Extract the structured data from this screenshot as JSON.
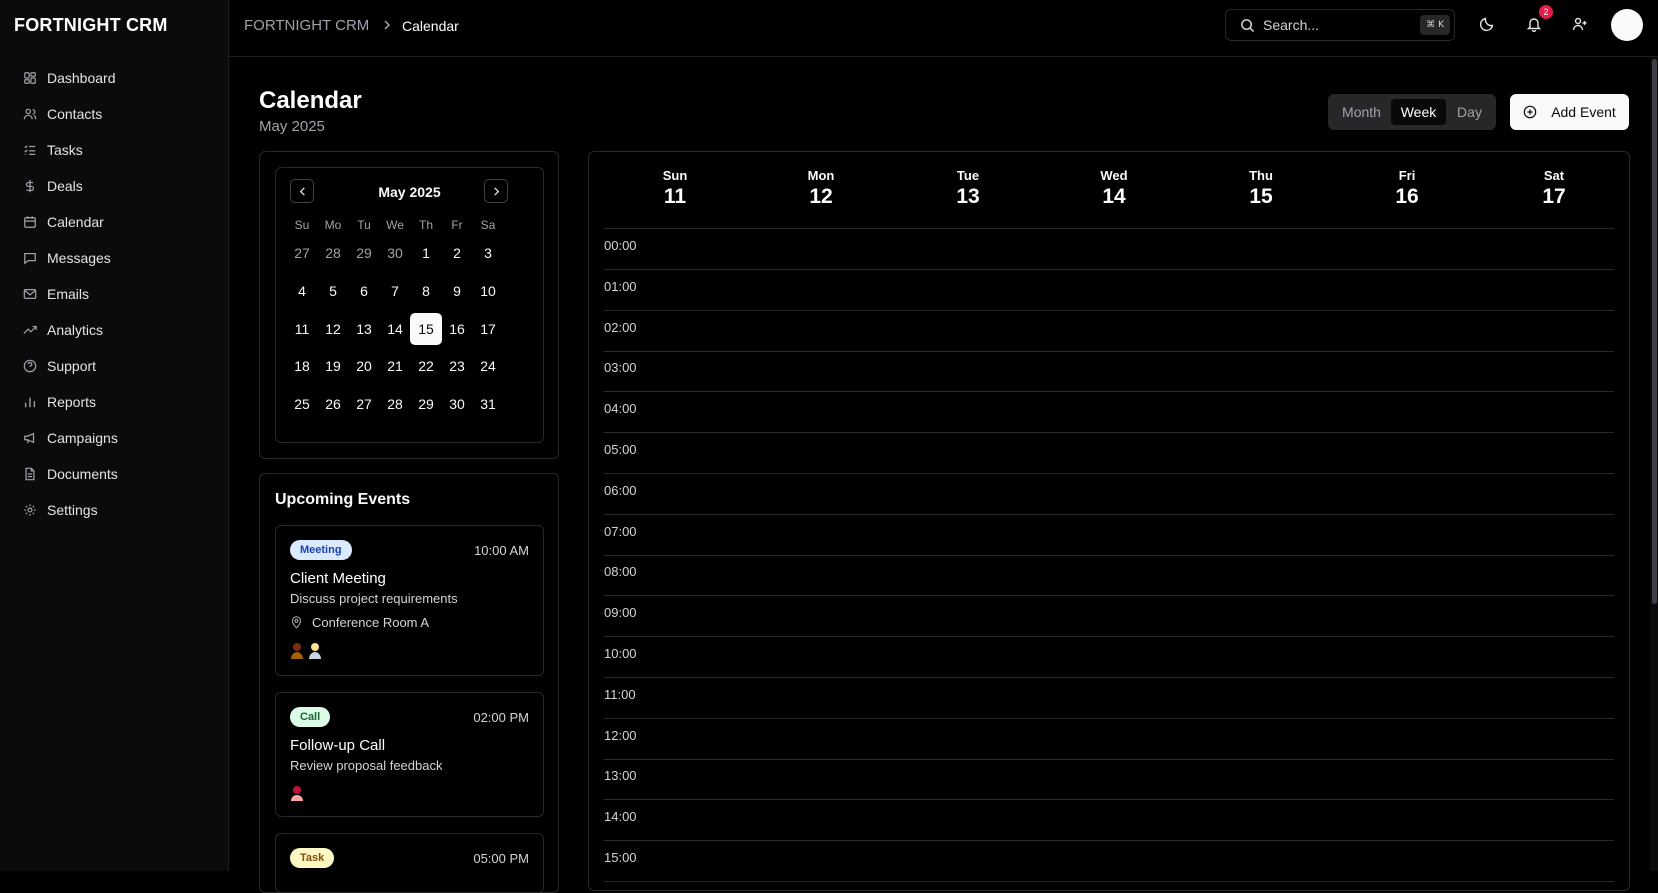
{
  "app": {
    "brand": "FORTNIGHT CRM"
  },
  "sidebar": {
    "items": [
      {
        "label": "Dashboard",
        "icon": "dashboard-icon"
      },
      {
        "label": "Contacts",
        "icon": "contacts-icon"
      },
      {
        "label": "Tasks",
        "icon": "tasks-icon"
      },
      {
        "label": "Deals",
        "icon": "dollar-icon"
      },
      {
        "label": "Calendar",
        "icon": "calendar-icon"
      },
      {
        "label": "Messages",
        "icon": "messages-icon"
      },
      {
        "label": "Emails",
        "icon": "mail-icon"
      },
      {
        "label": "Analytics",
        "icon": "trend-icon"
      },
      {
        "label": "Support",
        "icon": "help-icon"
      },
      {
        "label": "Reports",
        "icon": "bar-chart-icon"
      },
      {
        "label": "Campaigns",
        "icon": "megaphone-icon"
      },
      {
        "label": "Documents",
        "icon": "document-icon"
      },
      {
        "label": "Settings",
        "icon": "gear-icon"
      }
    ]
  },
  "topbar": {
    "breadcrumb_root": "FORTNIGHT CRM",
    "breadcrumb_current": "Calendar",
    "search_placeholder": "Search...",
    "search_shortcut": "⌘ K",
    "notification_count": "2"
  },
  "header": {
    "title": "Calendar",
    "subtitle": "May 2025",
    "views": {
      "month": "Month",
      "week": "Week",
      "day": "Day",
      "active": "Week"
    },
    "add_event_label": "Add Event"
  },
  "mini_calendar": {
    "month_label": "May 2025",
    "weekdays": [
      "Su",
      "Mo",
      "Tu",
      "We",
      "Th",
      "Fr",
      "Sa"
    ],
    "selected_day": "15",
    "weeks": [
      [
        {
          "d": "27",
          "muted": true
        },
        {
          "d": "28",
          "muted": true
        },
        {
          "d": "29",
          "muted": true
        },
        {
          "d": "30",
          "muted": true
        },
        {
          "d": "1"
        },
        {
          "d": "2"
        },
        {
          "d": "3"
        }
      ],
      [
        {
          "d": "4"
        },
        {
          "d": "5"
        },
        {
          "d": "6"
        },
        {
          "d": "7"
        },
        {
          "d": "8"
        },
        {
          "d": "9"
        },
        {
          "d": "10"
        }
      ],
      [
        {
          "d": "11"
        },
        {
          "d": "12"
        },
        {
          "d": "13"
        },
        {
          "d": "14"
        },
        {
          "d": "15",
          "selected": true
        },
        {
          "d": "16"
        },
        {
          "d": "17"
        }
      ],
      [
        {
          "d": "18"
        },
        {
          "d": "19"
        },
        {
          "d": "20"
        },
        {
          "d": "21"
        },
        {
          "d": "22"
        },
        {
          "d": "23"
        },
        {
          "d": "24"
        }
      ],
      [
        {
          "d": "25"
        },
        {
          "d": "26"
        },
        {
          "d": "27"
        },
        {
          "d": "28"
        },
        {
          "d": "29"
        },
        {
          "d": "30"
        },
        {
          "d": "31"
        }
      ]
    ]
  },
  "upcoming": {
    "title": "Upcoming Events",
    "events": [
      {
        "type": "Meeting",
        "time": "10:00 AM",
        "title": "Client Meeting",
        "description": "Discuss project requirements",
        "location": "Conference Room A",
        "attendees": 2
      },
      {
        "type": "Call",
        "time": "02:00 PM",
        "title": "Follow-up Call",
        "description": "Review proposal feedback",
        "attendees": 1
      },
      {
        "type": "Task",
        "time": "05:00 PM"
      }
    ]
  },
  "week": {
    "days": [
      {
        "name": "Sun",
        "num": "11"
      },
      {
        "name": "Mon",
        "num": "12"
      },
      {
        "name": "Tue",
        "num": "13"
      },
      {
        "name": "Wed",
        "num": "14"
      },
      {
        "name": "Thu",
        "num": "15"
      },
      {
        "name": "Fri",
        "num": "16"
      },
      {
        "name": "Sat",
        "num": "17"
      }
    ],
    "hours": [
      "00:00",
      "01:00",
      "02:00",
      "03:00",
      "04:00",
      "05:00",
      "06:00",
      "07:00",
      "08:00",
      "09:00",
      "10:00",
      "11:00",
      "12:00",
      "13:00",
      "14:00",
      "15:00"
    ]
  },
  "colors": {
    "background": "#000000",
    "badge_meeting": "#dbeafe",
    "badge_call": "#dcfce7",
    "badge_task": "#fef9c3",
    "notification": "#e11d48"
  }
}
